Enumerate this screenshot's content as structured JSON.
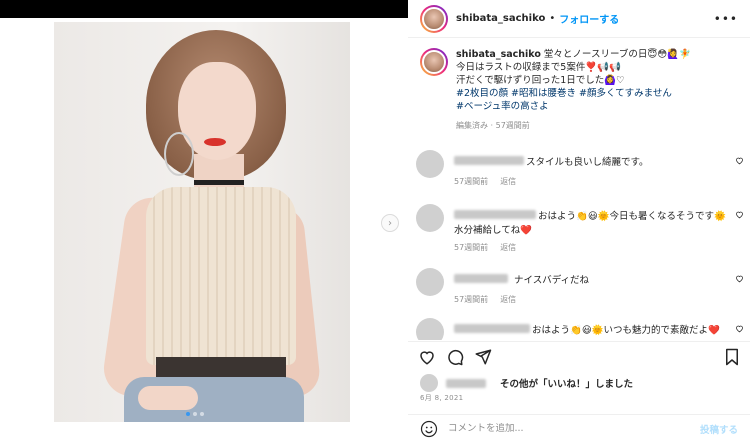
{
  "post": {
    "username": "shibata_sachiko",
    "follow_label": "フォローする",
    "separator": "•",
    "more_menu": "•••",
    "carousel": {
      "total_slides": 3,
      "active_slide": 1,
      "next_glyph": "›"
    }
  },
  "caption": {
    "username": "shibata_sachiko",
    "line1": " 堂々とノースリーブの日😇😳🙋‍♀️🧚",
    "line2": "今日はラストの収録まで5案件❣️📢📢",
    "line3": "汗だくで駆けずり回った1日でした🙆‍♀️♡",
    "tags_line1": "#2枚目の顔 #昭和は腰巻き #顔多くてすみません",
    "tags_line2": "#ベージュ率の高さよ",
    "meta": "編集済み · 57週間前"
  },
  "comments": [
    {
      "text": "スタイルも良いし綺麗です。",
      "time": "57週間前",
      "reply": "返信"
    },
    {
      "text": "おはよう👏😃🌞今日も暑くなるそうです🌞",
      "text2": "水分補給してね❤️",
      "time": "57週間前",
      "reply": "返信"
    },
    {
      "text": "ナイスバディだね",
      "time": "57週間前",
      "reply": "返信"
    },
    {
      "text": "おはよう👏😃🌞いつも魅力的で素敵だよ❤️",
      "time": "",
      "reply": ""
    }
  ],
  "likes": {
    "text": "その他が「いいね！」しました",
    "bold": "その他"
  },
  "date": "6月 8, 2021",
  "add_comment": {
    "placeholder": "コメントを追加...",
    "post_label": "投稿する"
  },
  "colors": {
    "link_blue": "#0095f6",
    "hashtag": "#00376b",
    "meta_gray": "#8e8e8e"
  }
}
